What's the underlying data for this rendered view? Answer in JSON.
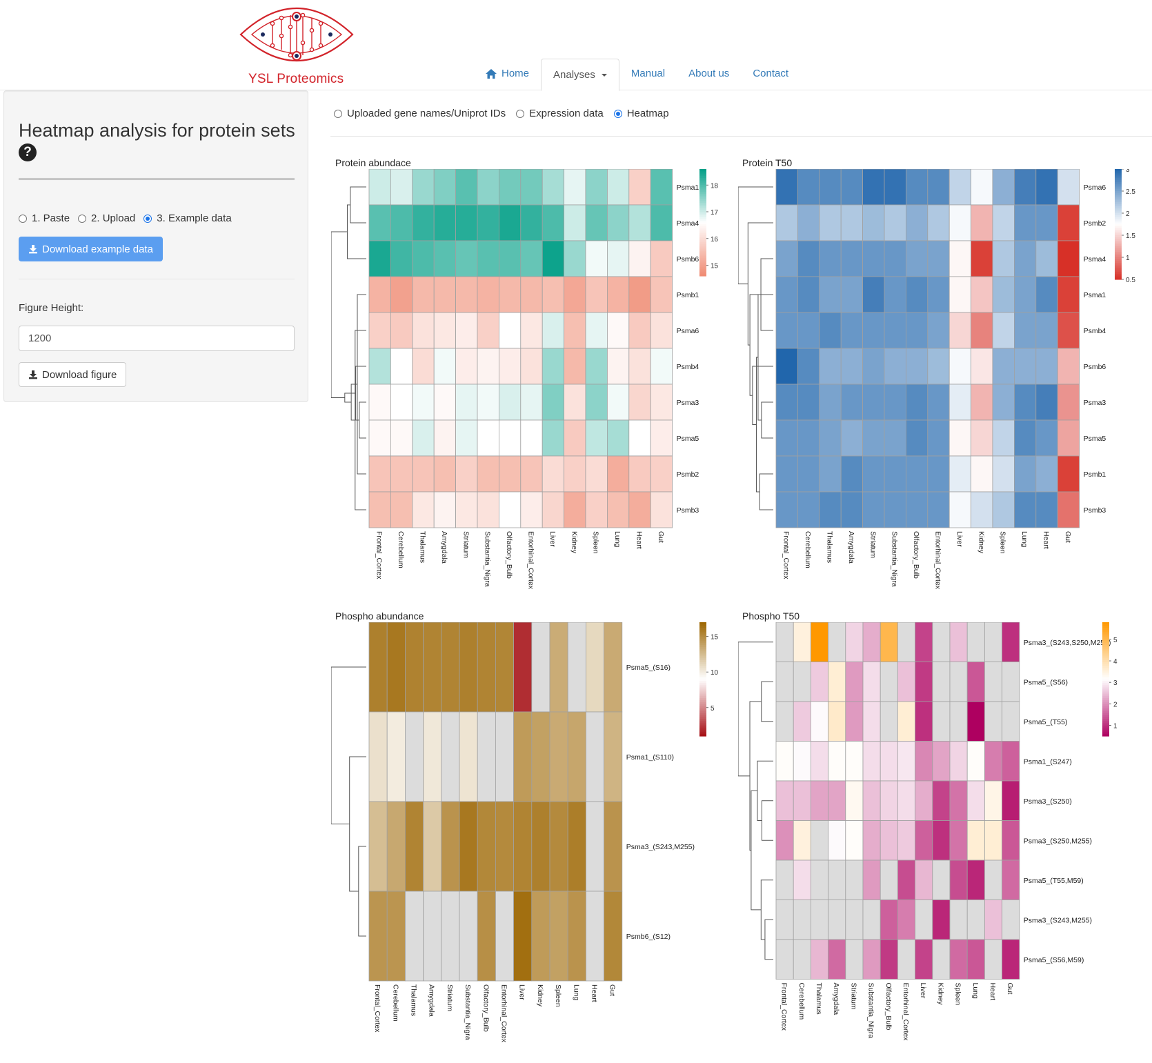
{
  "brand": {
    "name": "YSL Proteomics",
    "accent": "#d2232a",
    "link": "#337ab7"
  },
  "nav": [
    {
      "label": "Home",
      "icon": "home-icon",
      "active": false
    },
    {
      "label": "Analyses",
      "icon": "caret-down-icon",
      "active": true
    },
    {
      "label": "Manual",
      "active": false
    },
    {
      "label": "About us",
      "active": false
    },
    {
      "label": "Contact",
      "active": false
    }
  ],
  "sidebar": {
    "title": "Heatmap analysis for protein sets",
    "help_icon": "?",
    "input_modes": [
      {
        "label": "1. Paste",
        "selected": false
      },
      {
        "label": "2. Upload",
        "selected": false
      },
      {
        "label": "3. Example data",
        "selected": true
      }
    ],
    "download_example_label": "Download example data",
    "figure_height_label": "Figure Height:",
    "figure_height_value": "1200",
    "download_figure_label": "Download figure"
  },
  "main_tabs": [
    {
      "label": "Uploaded gene names/Uniprot IDs",
      "selected": false
    },
    {
      "label": "Expression data",
      "selected": false
    },
    {
      "label": "Heatmap",
      "selected": true
    }
  ],
  "chart_data": [
    {
      "type": "heatmap",
      "title": "Protein abundace",
      "x": [
        "Frontal_Cortex",
        "Cerebellum",
        "Thalamus",
        "Amygdala",
        "Striatum",
        "Substantia_Nigra",
        "Olfactory_Bulb",
        "Entorhinal_Cortex",
        "Liver",
        "Kidney",
        "Spleen",
        "Lung",
        "Heart",
        "Gut"
      ],
      "y": [
        "Psma1",
        "Psma4",
        "Psmb6",
        "Psmb1",
        "Psma6",
        "Psmb4",
        "Psma3",
        "Psma5",
        "Psmb2",
        "Psmb3"
      ],
      "legend_ticks": [
        18,
        17,
        16,
        15
      ],
      "color_range": [
        14.6,
        18.6
      ],
      "colors": [
        "#ef8a72",
        "#ffffff",
        "#009e86"
      ],
      "values": [
        [
          17.0,
          16.9,
          17.4,
          17.6,
          17.9,
          17.5,
          17.7,
          17.7,
          17.3,
          16.8,
          17.5,
          17.0,
          15.8,
          17.9
        ],
        [
          17.9,
          18.0,
          18.2,
          18.3,
          18.3,
          18.2,
          18.4,
          18.2,
          18.0,
          17.0,
          17.8,
          17.5,
          17.2,
          18.0
        ],
        [
          18.4,
          18.1,
          18.0,
          17.9,
          17.8,
          17.9,
          17.9,
          17.8,
          18.5,
          17.4,
          16.7,
          16.8,
          16.4,
          15.7
        ],
        [
          15.3,
          15.0,
          15.4,
          15.4,
          15.4,
          15.3,
          15.4,
          15.4,
          15.5,
          15.1,
          15.6,
          15.3,
          14.9,
          15.6
        ],
        [
          15.8,
          15.7,
          16.1,
          16.2,
          16.3,
          15.8,
          16.6,
          16.2,
          16.9,
          15.5,
          16.8,
          16.5,
          15.7,
          16.1
        ],
        [
          17.2,
          16.6,
          16.0,
          16.7,
          16.3,
          16.4,
          16.3,
          16.1,
          17.4,
          15.4,
          17.4,
          16.4,
          16.1,
          16.7
        ],
        [
          16.5,
          16.6,
          16.7,
          16.5,
          16.8,
          16.7,
          16.9,
          16.8,
          17.6,
          16.1,
          17.5,
          16.7,
          15.9,
          16.2
        ],
        [
          16.5,
          16.5,
          16.9,
          16.4,
          16.8,
          16.6,
          16.6,
          16.6,
          17.4,
          15.7,
          17.1,
          17.3,
          16.6,
          16.3
        ],
        [
          15.6,
          15.6,
          15.6,
          15.5,
          15.8,
          15.5,
          15.5,
          15.6,
          16.0,
          15.8,
          16.0,
          15.2,
          15.7,
          15.8
        ],
        [
          15.5,
          15.5,
          16.2,
          16.4,
          16.2,
          16.1,
          16.6,
          16.3,
          15.9,
          15.2,
          15.8,
          15.5,
          15.2,
          16.1
        ]
      ]
    },
    {
      "type": "heatmap",
      "title": "Protein T50",
      "x": [
        "Frontal_Cortex",
        "Cerebellum",
        "Thalamus",
        "Amygdala",
        "Striatum",
        "Substantia_Nigra",
        "Olfactory_Bulb",
        "Entorhinal_Cortex",
        "Liver",
        "Kidney",
        "Spleen",
        "Lung",
        "Heart",
        "Gut"
      ],
      "y": [
        "Psma6",
        "Psmb2",
        "Psma4",
        "Psma1",
        "Psmb4",
        "Psmb6",
        "Psma3",
        "Psma5",
        "Psmb1",
        "Psmb3"
      ],
      "legend_ticks": [
        3,
        2.5,
        2,
        1.5,
        1,
        0.5
      ],
      "color_range": [
        0.5,
        3.0
      ],
      "colors": [
        "#d73027",
        "#ffffff",
        "#2166ac"
      ],
      "values": [
        [
          2.9,
          2.7,
          2.7,
          2.7,
          2.9,
          2.9,
          2.7,
          2.7,
          2.1,
          1.8,
          2.4,
          2.8,
          2.9,
          2.0
        ],
        [
          2.2,
          2.4,
          2.2,
          2.2,
          2.3,
          2.2,
          2.4,
          2.2,
          1.8,
          1.3,
          2.1,
          2.6,
          2.6,
          0.6
        ],
        [
          2.5,
          2.7,
          2.6,
          2.6,
          2.6,
          2.6,
          2.5,
          2.5,
          1.7,
          0.6,
          2.2,
          2.5,
          2.3,
          0.5
        ],
        [
          2.6,
          2.7,
          2.5,
          2.5,
          2.8,
          2.6,
          2.7,
          2.6,
          1.7,
          1.4,
          2.3,
          2.5,
          2.7,
          0.6
        ],
        [
          2.6,
          2.6,
          2.7,
          2.6,
          2.6,
          2.6,
          2.6,
          2.5,
          1.5,
          1.0,
          2.1,
          2.5,
          2.5,
          0.7
        ],
        [
          3.0,
          2.7,
          2.4,
          2.4,
          2.5,
          2.4,
          2.4,
          2.3,
          1.8,
          1.6,
          2.4,
          2.4,
          2.4,
          1.3
        ],
        [
          2.7,
          2.7,
          2.5,
          2.6,
          2.6,
          2.6,
          2.7,
          2.6,
          1.9,
          1.3,
          2.4,
          2.7,
          2.8,
          1.1
        ],
        [
          2.6,
          2.6,
          2.5,
          2.4,
          2.5,
          2.5,
          2.7,
          2.6,
          1.7,
          1.5,
          2.1,
          2.7,
          2.6,
          1.2
        ],
        [
          2.6,
          2.6,
          2.5,
          2.7,
          2.6,
          2.6,
          2.6,
          2.6,
          1.9,
          1.7,
          2.0,
          2.5,
          2.4,
          0.6
        ],
        [
          2.6,
          2.6,
          2.7,
          2.7,
          2.6,
          2.6,
          2.6,
          2.6,
          1.8,
          2.0,
          2.2,
          2.7,
          2.7,
          0.9
        ]
      ]
    },
    {
      "type": "heatmap",
      "title": "Phospho abundance",
      "x": [
        "Frontal_Cortex",
        "Cerebellum",
        "Thalamus",
        "Amygdala",
        "Striatum",
        "Substantia_Nigra",
        "Olfactory_Bulb",
        "Entorhinal_Cortex",
        "Liver",
        "Kidney",
        "Spleen",
        "Lung",
        "Heart",
        "Gut"
      ],
      "y": [
        "Psma5_(S16)",
        "Psma1_(S110)",
        "Psma3_(S243,M255)",
        "Psmb6_(S12)"
      ],
      "legend_ticks": [
        15,
        10,
        5
      ],
      "color_range": [
        1,
        17
      ],
      "colors": [
        "#a50f15",
        "#ffffff",
        "#9c6500"
      ],
      "missing_color": "#dcdcdc",
      "values": [
        [
          15.6,
          16.0,
          15.5,
          15.4,
          15.4,
          15.6,
          15.4,
          15.3,
          2.0,
          null,
          13.3,
          null,
          11.0,
          13.4
        ],
        [
          10.6,
          10.0,
          null,
          10.2,
          null,
          10.4,
          null,
          null,
          14.2,
          13.9,
          13.4,
          13.6,
          null,
          12.9
        ],
        [
          12.4,
          13.5,
          15.4,
          11.8,
          14.6,
          16.0,
          15.2,
          15.1,
          15.4,
          15.6,
          15.1,
          15.7,
          null,
          14.6
        ],
        [
          14.5,
          14.5,
          null,
          null,
          null,
          null,
          14.8,
          null,
          16.5,
          14.2,
          13.9,
          14.6,
          null,
          15.2
        ]
      ]
    },
    {
      "type": "heatmap",
      "title": "Phospho T50",
      "x": [
        "Frontal_Cortex",
        "Cerebellum",
        "Thalamus",
        "Amygdala",
        "Striatum",
        "Substantia_Nigra",
        "Olfactory_Bulb",
        "Entorhinal_Cortex",
        "Liver",
        "Kidney",
        "Spleen",
        "Lung",
        "Heart",
        "Gut"
      ],
      "y": [
        "Psma3_(S243,S250,M255)",
        "Psma5_(S56)",
        "Psma5_(T55)",
        "Psma1_(S247)",
        "Psma3_(S250)",
        "Psma3_(S250,M255)",
        "Psma5_(T55,M59)",
        "Psma3_(S243,M255)",
        "Psma5_(S56,M59)"
      ],
      "legend_ticks": [
        5,
        4,
        3,
        2,
        1
      ],
      "color_range": [
        0.5,
        5.8
      ],
      "colors": [
        "#ae0060",
        "#ffffff",
        "#ff9800"
      ],
      "missing_color": "#dcdcdc",
      "values": [
        [
          null,
          3.5,
          5.8,
          null,
          2.7,
          2.3,
          5.0,
          null,
          1.2,
          null,
          2.5,
          null,
          null,
          1.0
        ],
        [
          null,
          null,
          2.6,
          3.6,
          2.1,
          2.8,
          null,
          2.5,
          1.1,
          null,
          null,
          1.4,
          null,
          null
        ],
        [
          null,
          2.6,
          3.1,
          3.7,
          2.1,
          2.8,
          null,
          3.6,
          1.0,
          null,
          null,
          0.5,
          null,
          null
        ],
        [
          3.2,
          3.1,
          2.8,
          3.2,
          3.2,
          2.8,
          2.8,
          2.9,
          1.9,
          2.2,
          2.7,
          3.2,
          1.8,
          1.5
        ],
        [
          2.5,
          2.5,
          2.2,
          2.2,
          3.3,
          2.5,
          2.7,
          2.8,
          2.3,
          1.2,
          1.7,
          2.8,
          3.4,
          0.8
        ],
        [
          2.0,
          3.5,
          null,
          3.1,
          3.2,
          2.3,
          2.5,
          2.6,
          1.5,
          1.0,
          1.7,
          3.6,
          3.6,
          1.4
        ],
        [
          null,
          2.8,
          null,
          null,
          null,
          2.1,
          null,
          1.3,
          2.4,
          null,
          1.3,
          0.9,
          null,
          1.6
        ],
        [
          null,
          null,
          null,
          null,
          null,
          null,
          1.5,
          1.8,
          null,
          0.9,
          null,
          null,
          2.5,
          null
        ],
        [
          null,
          null,
          2.4,
          1.6,
          null,
          2.1,
          1.1,
          null,
          1.2,
          null,
          1.6,
          1.4,
          null,
          0.9
        ]
      ]
    }
  ]
}
